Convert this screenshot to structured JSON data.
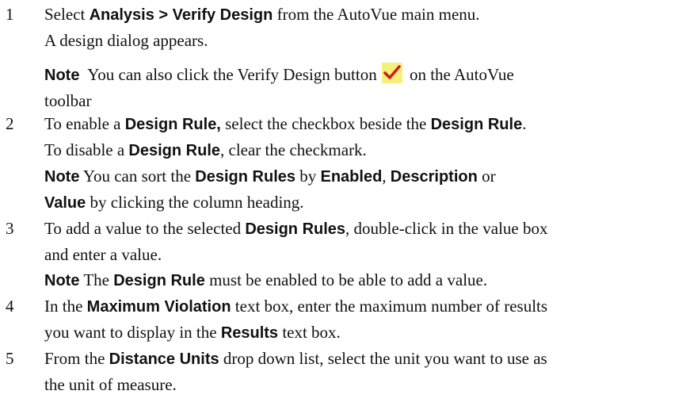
{
  "steps": [
    {
      "num": "1",
      "lines": [
        [
          "Select ",
          "Analysis > Verify Design",
          " from the AutoVue main menu."
        ],
        [
          "A design dialog appears."
        ]
      ],
      "note": {
        "label": "Note",
        "line1": "You can also click the Verify Design button",
        "line1_tail": "on the AutoVue",
        "line2": "toolbar",
        "icon": "verify-design-check-icon",
        "icon_colors": {
          "bg": "#f5f07a",
          "check": "#d21c1c"
        }
      }
    },
    {
      "num": "2",
      "lines": [
        [
          "To enable a ",
          "Design Rule,",
          " select the checkbox beside the ",
          "Design Rule",
          "."
        ],
        [
          "To disable a ",
          "Design Rule",
          ", clear the checkmark."
        ]
      ],
      "note_lines": [
        [
          "Note",
          " You can sort the ",
          "Design Rules",
          " by ",
          "Enabled",
          ", ",
          "Description",
          " or"
        ],
        [
          "Value",
          " by clicking the column heading."
        ]
      ]
    },
    {
      "num": "3",
      "lines": [
        [
          "To add a value to the selected ",
          "Design Rules",
          ", double-click in the value box"
        ],
        [
          "and enter a value."
        ]
      ],
      "note_lines": [
        [
          "Note",
          " The ",
          "Design Rule",
          " must be enabled to be able to add a value."
        ]
      ]
    },
    {
      "num": "4",
      "lines": [
        [
          "In the ",
          "Maximum Violation",
          " text box, enter the maximum number of results"
        ],
        [
          "you want to display in the ",
          "Results",
          " text box."
        ]
      ]
    },
    {
      "num": "5",
      "lines": [
        [
          "From the ",
          "Distance Units",
          " drop down list, select the unit you want to use as"
        ],
        [
          "the unit of measure."
        ]
      ]
    }
  ]
}
